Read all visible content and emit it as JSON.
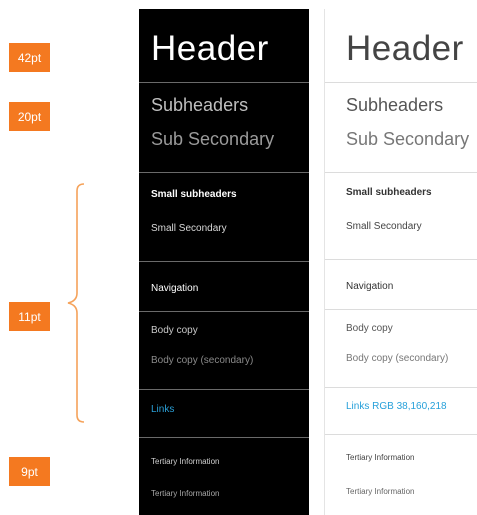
{
  "sizes": {
    "header": "42pt",
    "subheaders": "20pt",
    "small": "11pt",
    "tertiary": "9pt"
  },
  "dark": {
    "header": "Header",
    "subheaders": "Subheaders",
    "sub_secondary": "Sub Secondary",
    "small_subheaders": "Small subheaders",
    "small_secondary": "Small Secondary",
    "navigation": "Navigation",
    "body_copy": "Body copy",
    "body_copy_secondary": "Body copy (secondary)",
    "links": "Links",
    "tertiary_1": "Tertiary Information",
    "tertiary_2": "Tertiary Information"
  },
  "light": {
    "header": "Header",
    "subheaders": "Subheaders",
    "sub_secondary": "Sub Secondary",
    "small_subheaders": "Small subheaders",
    "small_secondary": "Small Secondary",
    "navigation": "Navigation",
    "body_copy": "Body copy",
    "body_copy_secondary": "Body copy (secondary)",
    "links": "Links RGB 38,160,218",
    "tertiary_1": "Tertiary Information",
    "tertiary_2": "Tertiary Information"
  },
  "colors": {
    "badge": "#f47920",
    "link": "#26a0da",
    "dark_bg": "#000000"
  }
}
